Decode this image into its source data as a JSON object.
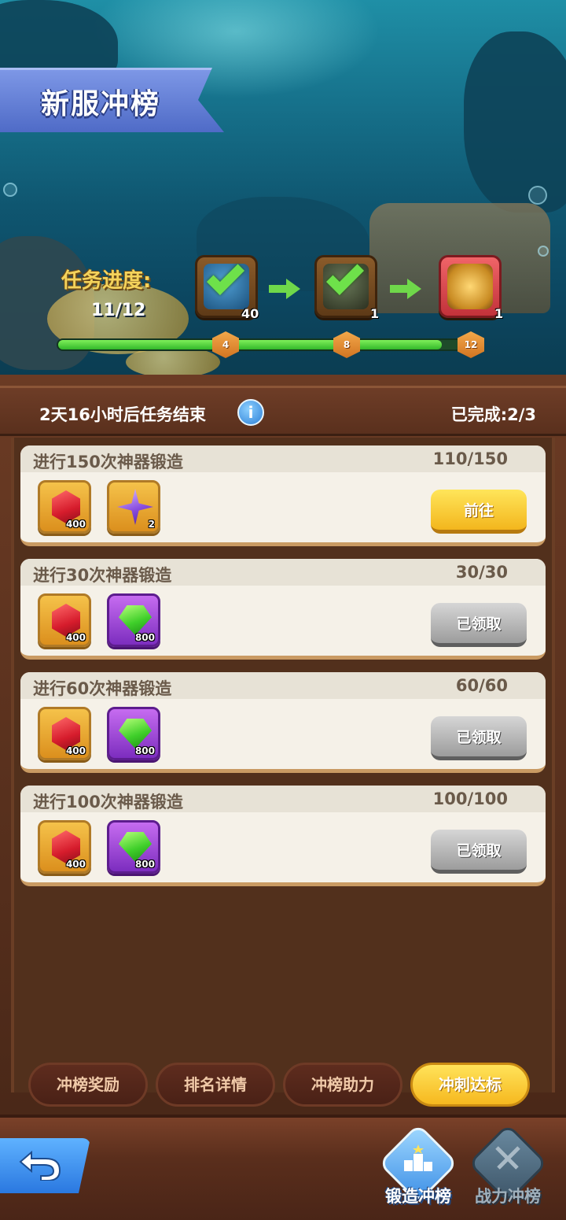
{
  "header": {
    "title": "新服冲榜",
    "task_label": "任务进度:",
    "task_count": "11/12",
    "stages": [
      {
        "name": "stage-1",
        "count": "40",
        "completed": true
      },
      {
        "name": "stage-2",
        "count": "1",
        "completed": true
      },
      {
        "name": "stage-3",
        "count": "1",
        "completed": false
      }
    ],
    "milestones": [
      "4",
      "8",
      "12"
    ],
    "progress_fraction": 0.917
  },
  "info_bar": {
    "time_left": "2天16小时后任务结束",
    "info_icon": "i",
    "completed": "已完成:2/3"
  },
  "tasks": [
    {
      "title": "进行150次神器锻造",
      "progress": "110/150",
      "rewards": [
        {
          "icon": "red-gem-icon",
          "count": "400"
        },
        {
          "icon": "star-shard-icon",
          "count": "2"
        }
      ],
      "button": "前往",
      "state": "go"
    },
    {
      "title": "进行30次神器锻造",
      "progress": "30/30",
      "rewards": [
        {
          "icon": "red-gem-icon",
          "count": "400"
        },
        {
          "icon": "green-gem-icon",
          "count": "800"
        }
      ],
      "button": "已领取",
      "state": "done"
    },
    {
      "title": "进行60次神器锻造",
      "progress": "60/60",
      "rewards": [
        {
          "icon": "red-gem-icon",
          "count": "400"
        },
        {
          "icon": "green-gem-icon",
          "count": "800"
        }
      ],
      "button": "已领取",
      "state": "done"
    },
    {
      "title": "进行100次神器锻造",
      "progress": "100/100",
      "rewards": [
        {
          "icon": "red-gem-icon",
          "count": "400"
        },
        {
          "icon": "green-gem-icon",
          "count": "800"
        }
      ],
      "button": "已领取",
      "state": "done"
    }
  ],
  "tabs": [
    {
      "label": "冲榜奖励",
      "active": false
    },
    {
      "label": "排名详情",
      "active": false
    },
    {
      "label": "冲榜助力",
      "active": false
    },
    {
      "label": "冲刺达标",
      "active": true
    }
  ],
  "bottom_nav": {
    "back_icon": "back-arrow-icon",
    "items": [
      {
        "label": "锻造冲榜",
        "icon": "podium-icon",
        "active": true
      },
      {
        "label": "战力冲榜",
        "icon": "crossed-swords-icon",
        "active": false
      }
    ]
  },
  "colors": {
    "accent_yellow": "#f6b81f",
    "wood_dark": "#4a2818",
    "progress_green": "#32b82a",
    "milestone_orange": "#d17421"
  }
}
